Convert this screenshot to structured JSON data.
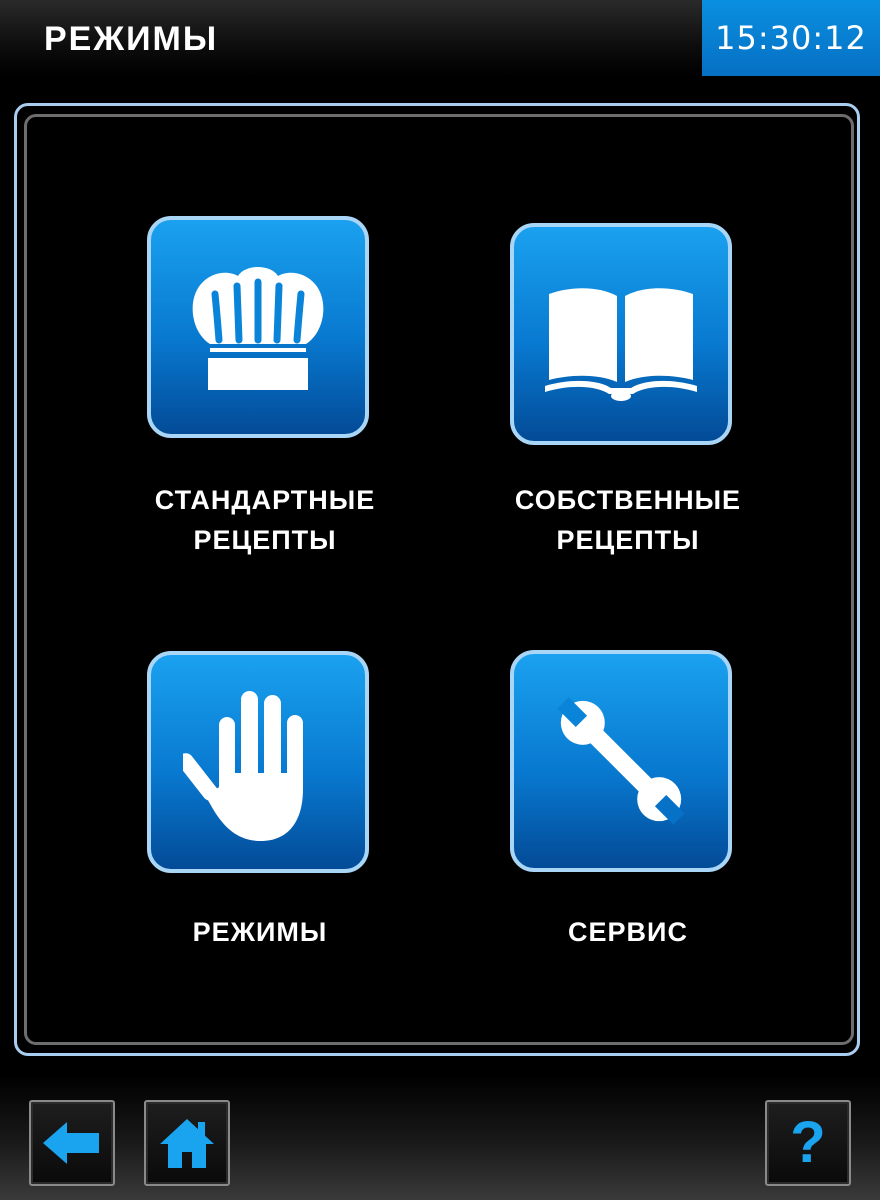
{
  "header": {
    "title": "РЕЖИМЫ",
    "time": "15:30:12"
  },
  "tiles": [
    {
      "icon": "chef-hat-icon",
      "line1": "СТАНДАРТНЫЕ",
      "line2": "РЕЦЕПТЫ"
    },
    {
      "icon": "open-book-icon",
      "line1": "СОБСТВЕННЫЕ",
      "line2": "РЕЦЕПТЫ"
    },
    {
      "icon": "hand-icon",
      "line1": "РЕЖИМЫ"
    },
    {
      "icon": "wrench-icon",
      "line1": "СЕРВИС"
    }
  ],
  "footer": {
    "back_icon": "back-arrow-icon",
    "home_icon": "home-icon",
    "help_label": "?"
  },
  "colors": {
    "accent": "#0a8fe0",
    "tile_border": "#a9d5f7",
    "background": "#000000"
  }
}
